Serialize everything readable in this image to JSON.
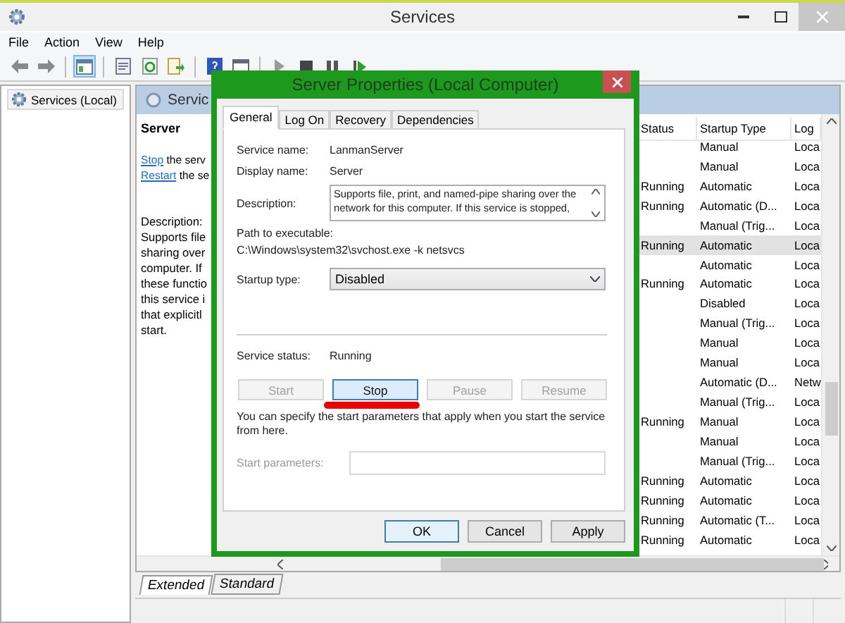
{
  "window": {
    "title": "Services"
  },
  "menu": [
    "File",
    "Action",
    "View",
    "Help"
  ],
  "toolbar": [
    {
      "kind": "back",
      "selected": false
    },
    {
      "kind": "forward",
      "selected": false
    },
    {
      "kind": "separator"
    },
    {
      "kind": "tree",
      "selected": true
    },
    {
      "kind": "separator"
    },
    {
      "kind": "properties",
      "selected": false
    },
    {
      "kind": "refresh",
      "selected": false
    },
    {
      "kind": "export",
      "selected": false
    },
    {
      "kind": "separator"
    },
    {
      "kind": "help",
      "selected": false
    },
    {
      "kind": "view",
      "selected": false
    },
    {
      "kind": "separator"
    },
    {
      "kind": "play",
      "selected": false
    },
    {
      "kind": "stop",
      "selected": false
    },
    {
      "kind": "pause",
      "selected": false
    },
    {
      "kind": "restart",
      "selected": false
    }
  ],
  "tree": {
    "items": [
      {
        "label": "Services (Local)",
        "selected": true
      }
    ]
  },
  "panel": {
    "title": "Servic",
    "service_name": "Server",
    "actions": [
      {
        "link": "Stop",
        "text": "the serv"
      },
      {
        "link": "Restart",
        "text": "the se"
      }
    ],
    "description_label": "Description:",
    "description_lines": [
      "Supports file",
      "sharing over",
      "computer. If",
      "these functio",
      "this service i",
      "that explicitl",
      "start."
    ]
  },
  "table": {
    "columns": [
      "Status",
      "Startup Type",
      "Log"
    ],
    "rows": [
      {
        "startup": "Manual",
        "log_on": "Loca",
        "selected": false
      },
      {
        "startup": "Manual",
        "log_on": "Loca",
        "selected": false
      },
      {
        "status": "Running",
        "startup": "Automatic",
        "log_on": "Loca",
        "selected": false
      },
      {
        "status": "Running",
        "startup": "Automatic (D...",
        "log_on": "Loca",
        "selected": false
      },
      {
        "startup": "Manual (Trig...",
        "log_on": "Loca",
        "selected": false
      },
      {
        "status": "Running",
        "startup": "Automatic",
        "log_on": "Loca",
        "selected": true
      },
      {
        "startup": "Automatic",
        "log_on": "Loca",
        "selected": false
      },
      {
        "status": "Running",
        "startup": "Automatic",
        "log_on": "Loca",
        "selected": false
      },
      {
        "startup": "Disabled",
        "log_on": "Loca",
        "selected": false
      },
      {
        "startup": "Manual (Trig...",
        "log_on": "Loca",
        "selected": false
      },
      {
        "startup": "Manual",
        "log_on": "Loca",
        "selected": false
      },
      {
        "startup": "Manual",
        "log_on": "Loca",
        "selected": false
      },
      {
        "startup": "Automatic (D...",
        "log_on": "Netw",
        "selected": false
      },
      {
        "startup": "Manual (Trig...",
        "log_on": "Loca",
        "selected": false
      },
      {
        "status": "Running",
        "startup": "Manual",
        "log_on": "Loca",
        "selected": false
      },
      {
        "startup": "Manual",
        "log_on": "Loca",
        "selected": false
      },
      {
        "startup": "Manual (Trig...",
        "log_on": "Loca",
        "selected": false
      },
      {
        "status": "Running",
        "startup": "Automatic",
        "log_on": "Loca",
        "selected": false
      },
      {
        "status": "Running",
        "startup": "Automatic",
        "log_on": "Loca",
        "selected": false
      },
      {
        "status": "Running",
        "startup": "Automatic (T...",
        "log_on": "Loca",
        "selected": false
      },
      {
        "status": "Running",
        "startup": "Automatic",
        "log_on": "Loca",
        "selected": false
      }
    ]
  },
  "view_tabs": [
    {
      "label": "Extended",
      "selected": true
    },
    {
      "label": "Standard",
      "selected": false
    }
  ],
  "dialog": {
    "title": "Server Properties (Local Computer)",
    "tabs": [
      {
        "label": "General",
        "selected": true
      },
      {
        "label": "Log On",
        "selected": false
      },
      {
        "label": "Recovery",
        "selected": false
      },
      {
        "label": "Dependencies",
        "selected": false
      }
    ],
    "service_name": {
      "label": "Service name:",
      "value": "LanmanServer"
    },
    "display_name": {
      "label": "Display name:",
      "value": "Server"
    },
    "description": {
      "label": "Description:",
      "value": "Supports file, print, and named-pipe sharing over the network for this computer. If this service is stopped,"
    },
    "path": {
      "label": "Path to executable:",
      "value": "C:\\Windows\\system32\\svchost.exe -k netsvcs"
    },
    "startup_type": {
      "label": "Startup type:",
      "value": "Disabled"
    },
    "status": {
      "label": "Service status:",
      "value": "Running"
    },
    "control_buttons": [
      {
        "label": "Start",
        "disabled": true,
        "highlighted": false
      },
      {
        "label": "Stop",
        "disabled": false,
        "highlighted": true
      },
      {
        "label": "Pause",
        "disabled": true,
        "highlighted": false
      },
      {
        "label": "Resume",
        "disabled": true,
        "highlighted": false
      }
    ],
    "hint": "You can specify the start parameters that apply when you start the service from here.",
    "start_parameters": {
      "label": "Start parameters:",
      "disabled": true
    },
    "buttons": [
      {
        "label": "OK",
        "default": true
      },
      {
        "label": "Cancel",
        "default": false
      },
      {
        "label": "Apply",
        "default": false
      }
    ]
  }
}
